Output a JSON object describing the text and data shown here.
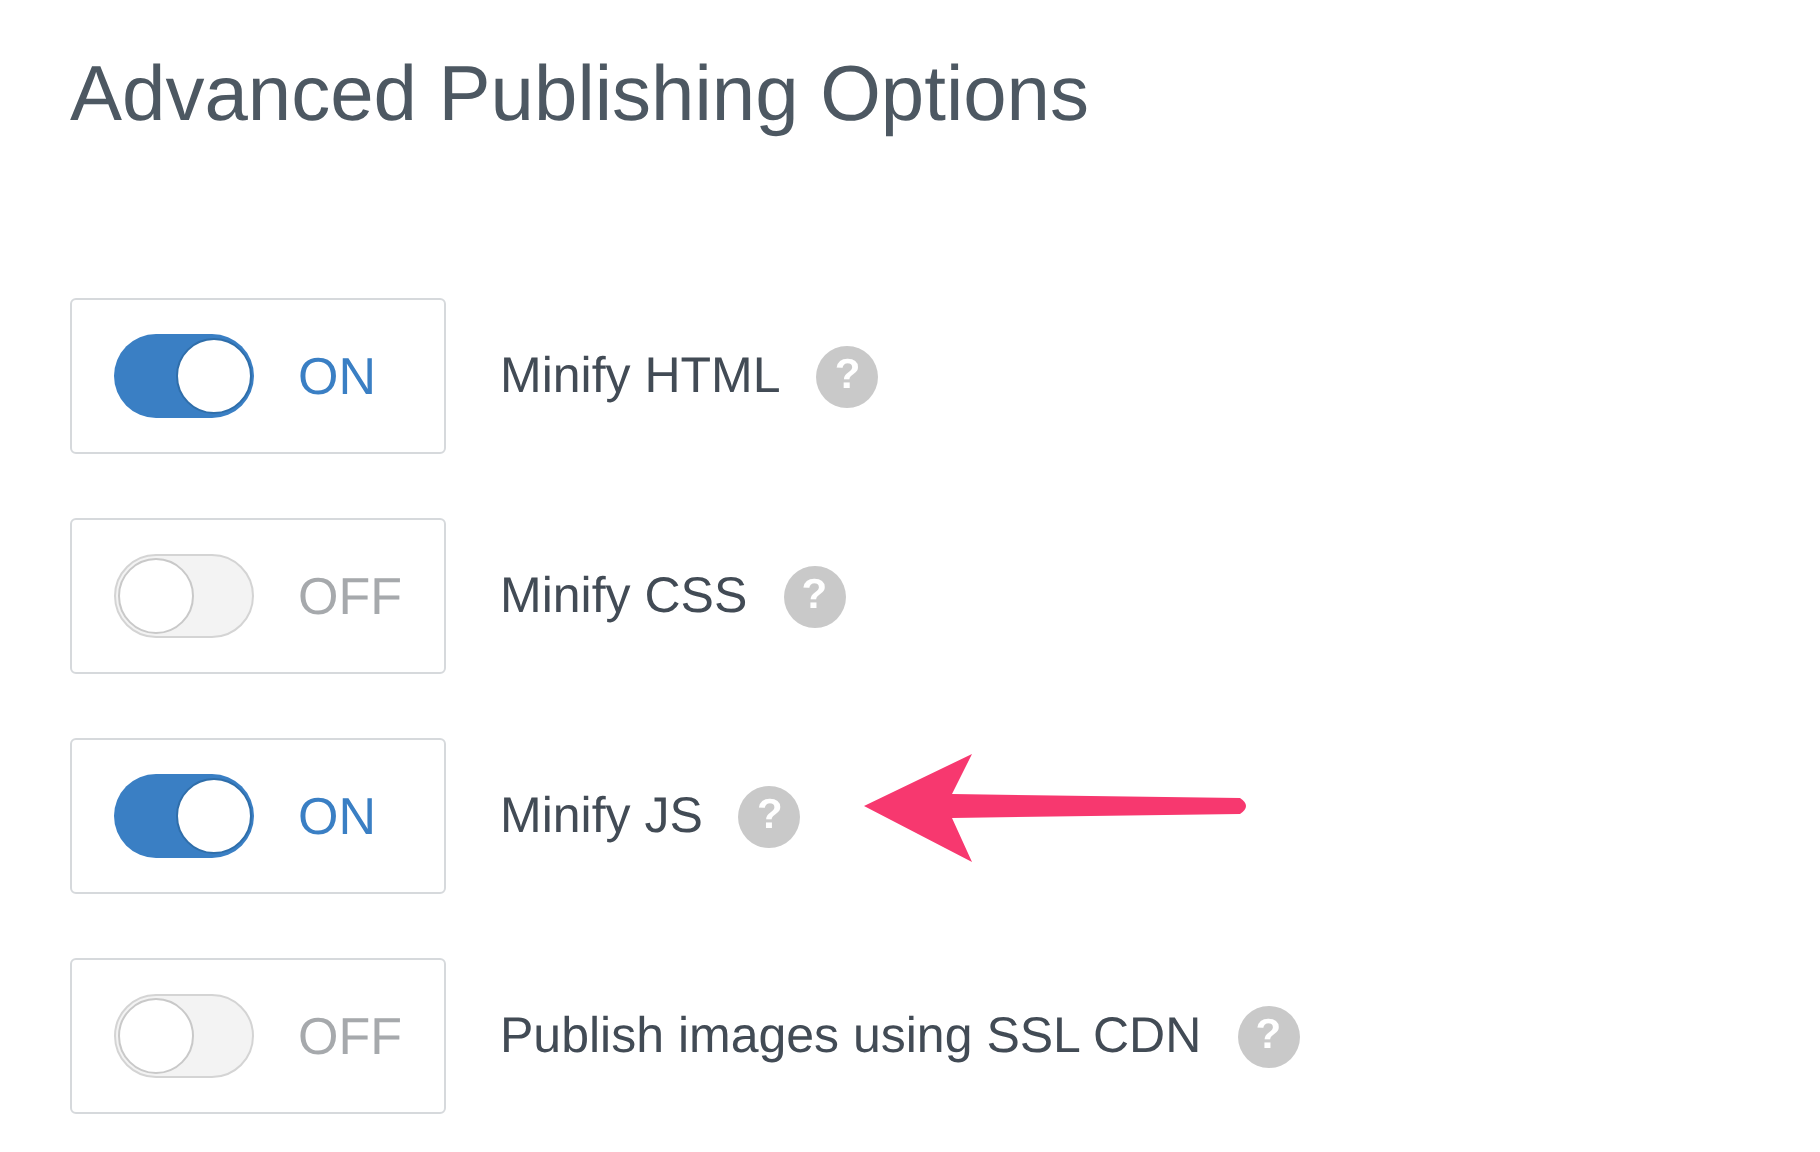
{
  "title": "Advanced Publishing Options",
  "options": [
    {
      "label": "Minify HTML",
      "on": true,
      "state_text": "ON",
      "help": "?",
      "highlighted": false
    },
    {
      "label": "Minify CSS",
      "on": false,
      "state_text": "OFF",
      "help": "?",
      "highlighted": false
    },
    {
      "label": "Minify JS",
      "on": true,
      "state_text": "ON",
      "help": "?",
      "highlighted": true
    },
    {
      "label": "Publish images using SSL CDN",
      "on": false,
      "state_text": "OFF",
      "help": "?",
      "highlighted": false
    }
  ]
}
